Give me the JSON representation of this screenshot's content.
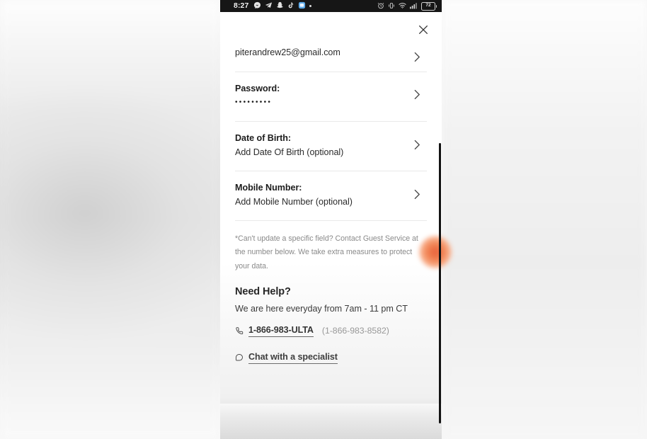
{
  "status_bar": {
    "time": "8:27",
    "left_icons": [
      "messenger-icon",
      "telegram-icon",
      "snapchat-icon",
      "tiktok-icon",
      "app-icon",
      "more-dot-icon"
    ],
    "right_icons": [
      "alarm-icon",
      "vibrate-icon",
      "wifi-icon",
      "signal-icon",
      "battery-icon"
    ],
    "battery_level": "72"
  },
  "sheet": {
    "close_label": "×",
    "fields": [
      {
        "name": "email",
        "label": "",
        "value": "piterandrew25@gmail.com",
        "chevron": "chevron-right-icon"
      },
      {
        "name": "password",
        "label": "Password:",
        "value": "•••••••••",
        "chevron": "chevron-right-icon"
      },
      {
        "name": "date-of-birth",
        "label": "Date of Birth:",
        "value": "Add Date Of Birth (optional)",
        "chevron": "chevron-right-icon"
      },
      {
        "name": "mobile-number",
        "label": "Mobile Number:",
        "value": "Add Mobile Number (optional)",
        "chevron": "chevron-right-icon"
      }
    ],
    "disclaimer": "*Can't update a specific field? Contact Guest Service at the number below. We take extra measures to protect your data.",
    "need_help": {
      "title": "Need Help?",
      "hours": "We are here everyday from 7am - 11 pm CT",
      "phone_link": "1-866-983-ULTA",
      "phone_alt": "(1-866-983-8582)",
      "chat_link": "Chat with a specialist"
    }
  },
  "colors": {
    "accent_orange": "#e8603c",
    "status_bar_bg": "#161616",
    "sheet_bg": "#ffffff",
    "divider": "#e9e9e9",
    "muted_text": "#8a8a8a",
    "scrollbar": "#131313"
  }
}
